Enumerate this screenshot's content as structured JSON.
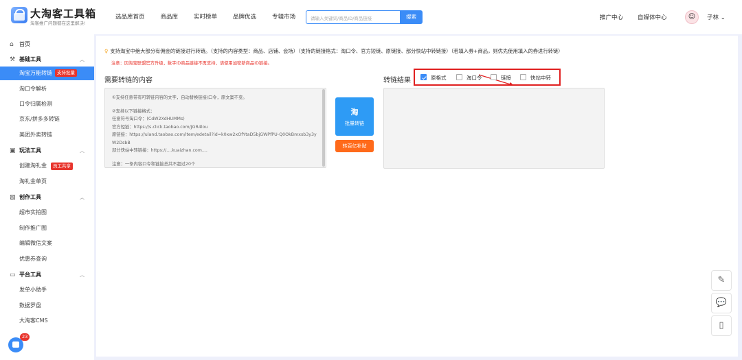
{
  "header": {
    "logo_title": "大淘客工具箱",
    "logo_sub": "淘客推广问题都在这里解决!",
    "nav": [
      "选品库首页",
      "商品库",
      "实时榜单",
      "品牌优选",
      "专辑市场"
    ],
    "search_placeholder": "请输入关键词/商品ID/商品链接",
    "search_button": "搜索",
    "promo_center": "推广中心",
    "media_center": "自媒体中心",
    "username": "子林"
  },
  "sidebar": {
    "home": "首页",
    "sections": [
      {
        "title": "基础工具",
        "items": [
          {
            "label": "淘宝万能转链",
            "badge": "支持批量",
            "active": true
          },
          {
            "label": "淘口令解析"
          },
          {
            "label": "口令归属检测"
          },
          {
            "label": "京东/拼多多转链"
          },
          {
            "label": "美团外卖转链"
          }
        ]
      },
      {
        "title": "玩法工具",
        "items": [
          {
            "label": "创建淘礼金",
            "badge": "员工共享"
          },
          {
            "label": "淘礼金单页"
          }
        ]
      },
      {
        "title": "创作工具",
        "items": [
          {
            "label": "超市实拍图"
          },
          {
            "label": "制作推广图"
          },
          {
            "label": "编辑微信文案"
          },
          {
            "label": "优惠券查询"
          }
        ]
      },
      {
        "title": "平台工具",
        "items": [
          {
            "label": "发单小助手"
          },
          {
            "label": "数据罗盘"
          },
          {
            "label": "大淘客CMS"
          }
        ]
      }
    ],
    "notification_count": "23"
  },
  "main": {
    "notice": "支持淘宝中绝大部分有佣金的链接进行转链。（支持的内容类型：商品、店铺、会场）（支持的链接格式：淘口令、官方短链、原链接、部分快站中转链接）（若填入券+商品，则优先使用填入的券进行转链）",
    "warning": "注意：因淘宝联盟官方升级，数字ID商品链接不再支持，请使用加密新商品ID链接。",
    "input_title": "需要转链的内容",
    "input_lines": [
      "①支持任意带有可转链内容的文字，自动替换链接/口令，原文案不变。",
      "",
      "②支持以下链接格式：",
      "任意符号淘口令：(CdW2XdHUMMs)",
      "官方短链：https://s.click.taobao.com/JGR4lou",
      "原链接：https://uland.taobao.com/item/edetail?id=k0xw2xOfYtaD5bjGWPfPU-Q0OkBmxsb3y3y",
      "W2DsbB",
      "部分快站中转链接：https://....kuaizhan.com....",
      "",
      "注意：一条内容口令和链接总共不超过20个"
    ],
    "batch_glyph": "淘",
    "batch_button": "批量转链",
    "subsidy_button": "转百亿补贴",
    "result_title": "转链结果",
    "options": [
      {
        "label": "原格式",
        "checked": true
      },
      {
        "label": "淘口令",
        "checked": false
      },
      {
        "label": "链接",
        "checked": false
      },
      {
        "label": "快站中转",
        "checked": false
      }
    ]
  },
  "colors": {
    "accent": "#3b8cf7",
    "danger": "#e8342c",
    "orange": "#ff6a1a"
  }
}
